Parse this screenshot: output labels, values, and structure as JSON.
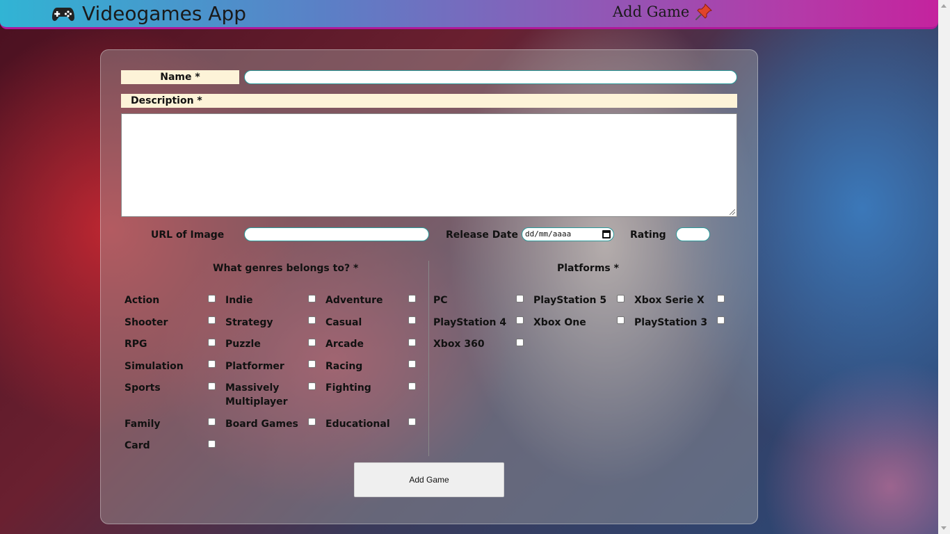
{
  "header": {
    "brand": "Videogames App",
    "brand_icon": "gamepad-icon",
    "nav_add": "Add Game",
    "nav_add_icon": "pushpin-icon"
  },
  "form": {
    "name_label": "Name *",
    "name_value": "",
    "description_label": "Description *",
    "description_value": "",
    "url_label": "URL of Image",
    "url_value": "",
    "release_label": "Release Date",
    "release_placeholder": "dd/mm/aaaa",
    "rating_label": "Rating",
    "rating_value": "",
    "genres_title": "What genres belongs to? *",
    "platforms_title": "Platforms *",
    "submit_label": "Add Game"
  },
  "genres": [
    "Action",
    "Indie",
    "Adventure",
    "Shooter",
    "Strategy",
    "Casual",
    "RPG",
    "Puzzle",
    "Arcade",
    "Simulation",
    "Platformer",
    "Racing",
    "Sports",
    "Massively Multiplayer",
    "Fighting",
    "Family",
    "Board Games",
    "Educational",
    "Card"
  ],
  "platforms": [
    "PC",
    "PlayStation 5",
    "Xbox Serie X",
    "PlayStation 4",
    "Xbox One",
    "PlayStation 3",
    "Xbox 360"
  ],
  "colors": {
    "header_gradient_start": "#31b4d4",
    "header_gradient_end": "#c4239e",
    "label_bg": "#fdf3d8",
    "input_border": "#2a9a9a"
  }
}
